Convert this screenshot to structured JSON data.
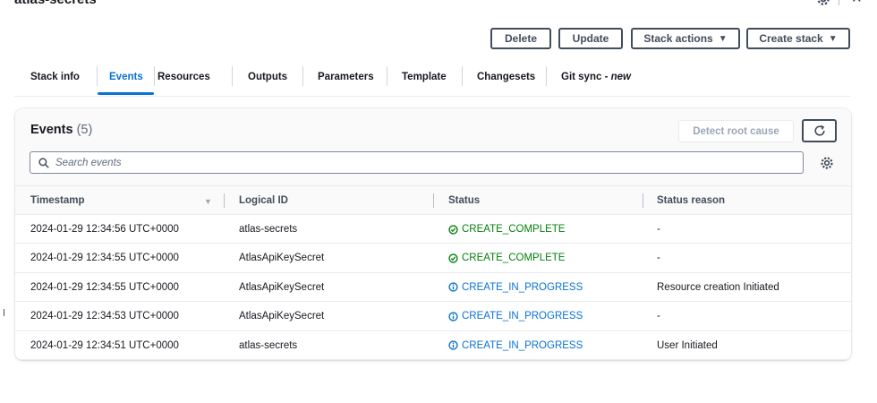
{
  "header": {
    "title": "atlas-secrets"
  },
  "actions": {
    "delete": "Delete",
    "update": "Update",
    "stack_actions": "Stack actions",
    "create_stack": "Create stack"
  },
  "tabs": [
    {
      "label": "Stack info"
    },
    {
      "label": "Events"
    },
    {
      "label": "Resources"
    },
    {
      "label": "Outputs"
    },
    {
      "label": "Parameters"
    },
    {
      "label": "Template"
    },
    {
      "label": "Changesets"
    },
    {
      "label": "Git sync - ",
      "suffix": "new"
    }
  ],
  "events": {
    "title": "Events",
    "count": "(5)",
    "detect_root_cause": "Detect root cause",
    "search_placeholder": "Search events",
    "columns": [
      "Timestamp",
      "Logical ID",
      "Status",
      "Status reason"
    ],
    "rows": [
      {
        "timestamp": "2024-01-29 12:34:56 UTC+0000",
        "logical_id": "atlas-secrets",
        "status": "CREATE_COMPLETE",
        "status_type": "complete",
        "reason": "-"
      },
      {
        "timestamp": "2024-01-29 12:34:55 UTC+0000",
        "logical_id": "AtlasApiKeySecret",
        "status": "CREATE_COMPLETE",
        "status_type": "complete",
        "reason": "-"
      },
      {
        "timestamp": "2024-01-29 12:34:55 UTC+0000",
        "logical_id": "AtlasApiKeySecret",
        "status": "CREATE_IN_PROGRESS",
        "status_type": "progress",
        "reason": "Resource creation Initiated"
      },
      {
        "timestamp": "2024-01-29 12:34:53 UTC+0000",
        "logical_id": "AtlasApiKeySecret",
        "status": "CREATE_IN_PROGRESS",
        "status_type": "progress",
        "reason": "-"
      },
      {
        "timestamp": "2024-01-29 12:34:51 UTC+0000",
        "logical_id": "atlas-secrets",
        "status": "CREATE_IN_PROGRESS",
        "status_type": "progress",
        "reason": "User Initiated"
      }
    ]
  },
  "icons": {
    "settings": "gear-icon",
    "close": "close-icon",
    "refresh": "refresh-icon",
    "search": "search-icon",
    "success": "check-circle-icon",
    "info": "info-circle-icon",
    "sort": "caret-down-icon"
  },
  "colors": {
    "accent": "#0972d3",
    "success": "#037f0c",
    "text": "#16191f",
    "muted": "#5f6b7a"
  }
}
